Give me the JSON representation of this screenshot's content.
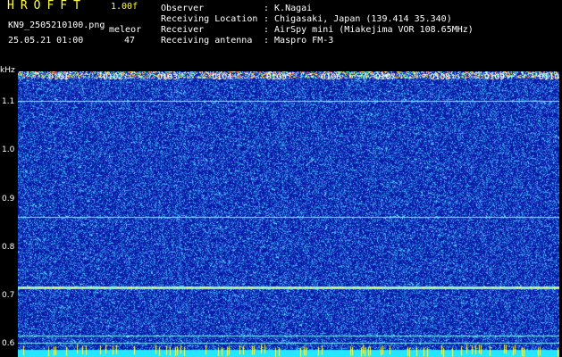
{
  "header": {
    "app_title": "HROFFT",
    "version": "1.00f",
    "file_name": "KN9_2505210100.png",
    "mode": "meleor",
    "datetime": "25.05.21 01:00",
    "count": "47",
    "fields": [
      {
        "label": "Observer",
        "value": ": K.Nagai"
      },
      {
        "label": "Receiving Location",
        "value": ": Chigasaki, Japan (139.414 35.340)"
      },
      {
        "label": "Receiver",
        "value": ": AirSpy mini (Miakejima VOR 108.65MHz)"
      },
      {
        "label": "Receiving antenna",
        "value": ": Maspro FM-3"
      }
    ]
  },
  "spectrogram": {
    "unit": "kHz",
    "y_ticks": [
      "1.1",
      "1.0",
      "0.9",
      "0.8",
      "0.7",
      "0.6"
    ],
    "y_values": [
      1.1,
      1.0,
      0.9,
      0.8,
      0.7,
      0.6
    ],
    "y_range": [
      0.575,
      1.165
    ],
    "time_labels": [
      "0101",
      "0102",
      "0103",
      "0104",
      "0105",
      "0106",
      "0107",
      "0108",
      "0109",
      "0110"
    ],
    "lines_khz": [
      1.105,
      0.865,
      0.72,
      0.62,
      0.605
    ],
    "colors": {
      "background": "#0a1aa8",
      "noise": "#2f6cff",
      "line": "#7ff0ff",
      "bottom_band": "#24e6ff"
    }
  }
}
